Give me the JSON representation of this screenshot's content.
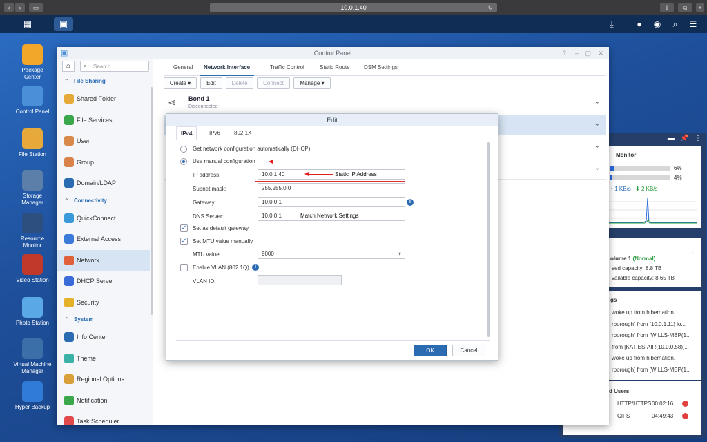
{
  "browser": {
    "url": "10.0.1.40"
  },
  "desktop": {
    "icons": [
      {
        "label": "Package\nCenter",
        "color": "#f2a72a"
      },
      {
        "label": "Control Panel",
        "color": "#4a90d9"
      },
      {
        "label": "File Station",
        "color": "#e6a93a"
      },
      {
        "label": "Storage\nManager",
        "color": "#5b7fa8"
      },
      {
        "label": "Resource\nMonitor",
        "color": "#2d4f80"
      },
      {
        "label": "Video Station",
        "color": "#c0392b"
      },
      {
        "label": "Photo Station",
        "color": "#5aa9e6"
      },
      {
        "label": "Virtual Machine\nManager",
        "color": "#3b6fa8"
      },
      {
        "label": "Hyper Backup",
        "color": "#2f7bd6"
      }
    ]
  },
  "widget": {
    "title": "Monitor",
    "cpu_pct": "6%",
    "ram_pct": "4%",
    "cpu_fill": 0.06,
    "ram_fill": 0.04,
    "upload": "1 KB/s",
    "download": "2 KB/s",
    "volume_name": "olume 1",
    "volume_status": "(Normal)",
    "used_capacity": "sed capacity: 8.8 TB",
    "avail_capacity": "vailable capacity: 8.65 TB",
    "logs_title": "gs",
    "logs": [
      "woke up from hibernation.",
      "rborough] from [10.0.1.11] lo...",
      "rborough] from [WILLS-MBP(1...",
      "from [KATIES-AIR(10.0.0.58)]...",
      "woke up from hibernation.",
      "rborough] from [WILLS-MBP(1..."
    ],
    "users_title": "d Users",
    "users": [
      {
        "proto": "HTTP/HTTPS",
        "time": "00:02:16"
      },
      {
        "proto": "CIFS",
        "time": "04:49:43"
      }
    ]
  },
  "control_panel": {
    "title": "Control Panel",
    "search_placeholder": "Search",
    "sidebar": [
      {
        "type": "section",
        "label": "File Sharing"
      },
      {
        "type": "item",
        "label": "Shared Folder",
        "color": "#e6a93a"
      },
      {
        "type": "item",
        "label": "File Services",
        "color": "#3aa84a"
      },
      {
        "type": "item",
        "label": "User",
        "color": "#d98a4a"
      },
      {
        "type": "item",
        "label": "Group",
        "color": "#d9824a"
      },
      {
        "type": "item",
        "label": "Domain/LDAP",
        "color": "#2a6bb2"
      },
      {
        "type": "section",
        "label": "Connectivity"
      },
      {
        "type": "item",
        "label": "QuickConnect",
        "color": "#3a9ad9"
      },
      {
        "type": "item",
        "label": "External Access",
        "color": "#3a7ad9"
      },
      {
        "type": "item",
        "label": "Network",
        "color": "#e0603a",
        "selected": true
      },
      {
        "type": "item",
        "label": "DHCP Server",
        "color": "#3a6bd9"
      },
      {
        "type": "item",
        "label": "Security",
        "color": "#e6b12a"
      },
      {
        "type": "section",
        "label": "System"
      },
      {
        "type": "item",
        "label": "Info Center",
        "color": "#2a6bb2"
      },
      {
        "type": "item",
        "label": "Theme",
        "color": "#3ab2a8"
      },
      {
        "type": "item",
        "label": "Regional Options",
        "color": "#d9a03a"
      },
      {
        "type": "item",
        "label": "Notification",
        "color": "#3aa84a"
      },
      {
        "type": "item",
        "label": "Task Scheduler",
        "color": "#e04a4a"
      }
    ],
    "tabs": [
      "General",
      "Network Interface",
      "Traffic Control",
      "Static Route",
      "DSM Settings"
    ],
    "toolbar": {
      "create": "Create",
      "edit": "Edit",
      "delete": "Delete",
      "connect": "Connect",
      "manage": "Manage"
    },
    "interfaces": [
      {
        "name": "Bond 1",
        "status": "Disconnected"
      }
    ]
  },
  "dialog": {
    "title": "Edit",
    "tabs": [
      "IPv4",
      "IPv6",
      "802.1X"
    ],
    "dhcp_label": "Get network configuration automatically (DHCP)",
    "manual_label": "Use manual configuration",
    "ip_label": "IP address:",
    "ip_value": "10.0.1.40",
    "subnet_label": "Subnet mask:",
    "subnet_value": "255.255.0.0",
    "gateway_label": "Gateway:",
    "gateway_value": "10.0.0.1",
    "dns_label": "DNS Server:",
    "dns_value": "10.0.0.1",
    "default_gw_label": "Set as default gateway",
    "mtu_manual_label": "Set MTU value manually",
    "mtu_label": "MTU value:",
    "mtu_value": "9000",
    "vlan_label": "Enable VLAN (802.1Q)",
    "vlan_id_label": "VLAN ID:",
    "ok": "OK",
    "cancel": "Cancel",
    "annotation_static": "Static IP Address",
    "annotation_match": "Match Network Settings"
  }
}
